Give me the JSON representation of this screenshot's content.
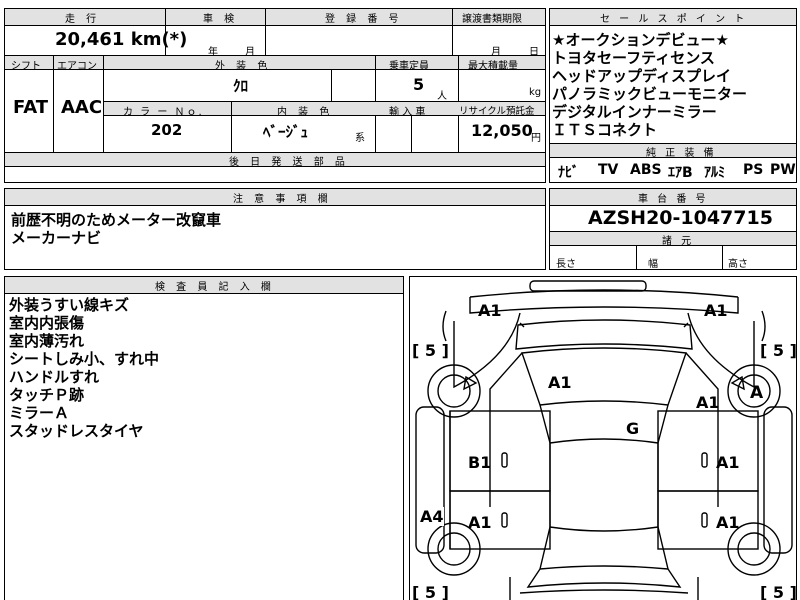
{
  "top_partial": {
    "text": ""
  },
  "sheet": {
    "mileage_header": "走 行",
    "mileage_value": "20,461 km(*)",
    "inspection_header": "車 検",
    "inspection_year": "年",
    "inspection_month": "月",
    "registration_header": "登 録 番 号",
    "transfer_header": "譲渡書類期限",
    "transfer_month": "月",
    "transfer_day": "日",
    "shift_header": "シフト",
    "aircon_header": "エアコン",
    "exterior_color_header": "外 装 色",
    "capacity_header": "乗車定員",
    "max_load_header": "最大積載量",
    "shift_value": "FAT",
    "aircon_value": "AAC",
    "exterior_color_value": "ｸﾛ",
    "capacity_value": "5",
    "capacity_unit": "人",
    "load_unit": "kg",
    "color_no_header": "カ ラ ー Ｎｏ.",
    "interior_color_header": "内 装 色",
    "import_header": "輸 入 車",
    "recycle_header": "リサイクル預託金",
    "color_no_value": "202",
    "interior_color_value": "ﾍﾞｰｼﾞｭ",
    "interior_color_suffix": "系",
    "recycle_value": "12,050",
    "recycle_unit": "円",
    "parts_header": "後 日 発 送 部 品"
  },
  "sales_points": {
    "header": "セ ー ル ス ポ イ ン ト",
    "items": [
      "★オークションデビュー★",
      "トヨタセーフティセンス",
      "ヘッドアップディスプレイ",
      "パノラミックビューモニター",
      "デジタルインナーミラー",
      "ＩＴＳコネクト"
    ],
    "equipment_header": "純 正 装 備",
    "equipment": [
      "ﾅﾋﾞ",
      "TV",
      "ABS",
      "ｴｱB",
      "ｱﾙﾐ",
      "PS",
      "PW"
    ]
  },
  "notes": {
    "header": "注 意 事 項 欄",
    "lines": [
      "前歴不明のためメーター改竄車",
      "メーカーナビ"
    ]
  },
  "chassis": {
    "header": "車 台 番 号",
    "value": "AZSH20-1047715",
    "specs_header": "諸 元",
    "length_label": "長さ",
    "width_label": "幅",
    "height_label": "高さ"
  },
  "inspector": {
    "header": "検 査 員 記 入 欄",
    "lines": [
      "外装うすい線キズ",
      "室内内張傷",
      "室内薄汚れ",
      "シートしみ小、すれ中",
      "ハンドルすれ",
      "タッチＰ跡",
      "ミラーＡ",
      "スタッドレスタイヤ"
    ]
  },
  "diagram": {
    "labels": {
      "front_left": "A1",
      "front_right": "A1",
      "tire_fl": "[ 5 ]",
      "tire_fr": "[ 5 ]",
      "tire_rl": "[ 5 ]",
      "tire_rr": "[ 5 ]",
      "windshield": "A1",
      "wheel_fr": "A",
      "right_fender": "A1",
      "roof": "G",
      "left_front_door": "B1",
      "right_front_door": "A1",
      "left_rear_side": "A4",
      "left_rear_door": "A1",
      "right_rear_door": "A1"
    }
  }
}
